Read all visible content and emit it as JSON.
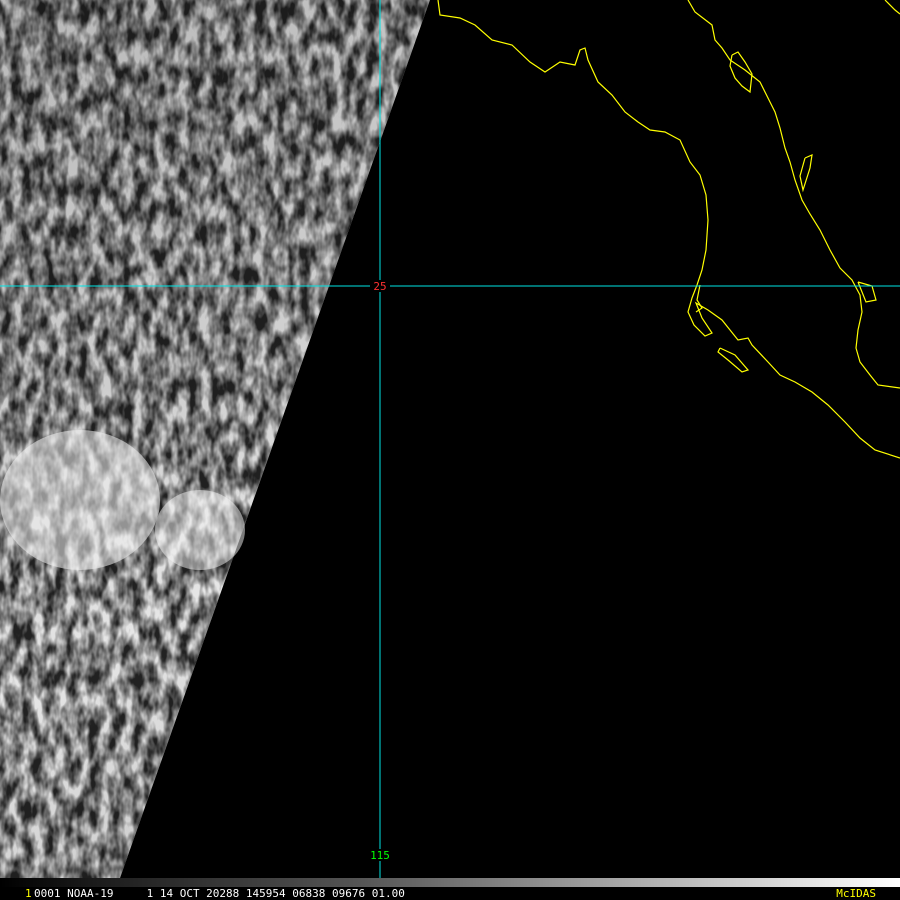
{
  "satellite_image": {
    "grid": {
      "latitude_label": "25",
      "longitude_label": "115",
      "grid_color": "#00e5e5",
      "latitude_label_color": "#ff3030",
      "longitude_label_color": "#00ff00"
    },
    "coastline_color": "#ffff00",
    "background_color": "#000000"
  },
  "status_bar": {
    "frame_number": "1",
    "info_line": "0001 NOAA-19     1 14 OCT 20288 145954 06838 09676 01.00",
    "brand": "McIDAS"
  }
}
